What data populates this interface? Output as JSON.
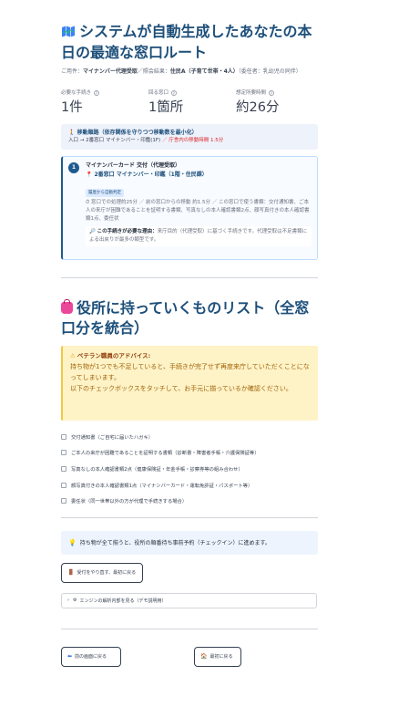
{
  "header": {
    "title": "システムが自動生成したあなたの本日の最適な窓口ルート",
    "meta_purpose_label": "ご用件：",
    "meta_purpose": "マイナンバー代理受取",
    "meta_sep1": "／照会結果：",
    "meta_result": "住民A（子育て世帯・4人）",
    "meta_note": "（委任者：乳幼児の同伴）"
  },
  "stats": [
    {
      "label": "必要な手続き",
      "value": "1件"
    },
    {
      "label": "回る窓口",
      "value": "1箇所"
    },
    {
      "label": "想定所要時間",
      "value": "約26分"
    }
  ],
  "route": {
    "title": "移動順路（依存関係を守りつつ移動数を最小化）",
    "path": "入口 → 2番窓口 マイナンバー・印鑑(1F)",
    "sep": "／",
    "time": "庁舎内の移動時間 1.5分"
  },
  "step": {
    "number": "1",
    "title": "マイナンバーカード 交付（代理受取）",
    "place": "2番窓口 マイナンバー・印鑑（1階・住民課）",
    "tag": "履歴から自動判定",
    "desc": "⏱ 窓口での処理約25分 ／ 前の窓口からの移動 約1.5分 ／ この窓口で使う書類：交付通知書、ご本人の来庁が困難であることを証明する書類、写真なしの本人確認書類2点、顔写真付きの本人確認書類1点、委任状",
    "why_label": "この手続きが必要な理由：",
    "why_text": "来庁目的（代理受取）に基づく手続きです。代理受取は不足書類による出戻りが最多の類型です。"
  },
  "checklist": {
    "title": "役所に持っていくものリスト（全窓口分を統合）",
    "advice_title": "ベテラン職員のアドバイス:",
    "advice_text1": "持ち物が1つでも不足していると、手続きが完了せず再度来庁していただくことになってしまいます。",
    "advice_text2": "以下のチェックボックスをタッチして、お手元に揃っているか確認ください。",
    "items": [
      "交付通知書（ご自宅に届いたハガキ）",
      "ご本人の来庁が困難であることを証明する書類（診断書・障害者手帳・介護保険証等）",
      "写真なしの本人確認書類2点（健康保険証・年金手帳・診察券等の組み合わせ）",
      "顔写真付きの本人確認書類1点（マイナンバーカード・運転免許証・パスポート等）",
      "委任状（同一世帯以外の方が代理で手続きする場合）"
    ]
  },
  "info": {
    "text": "持ち物が全て揃うと、役所の順番待ち事前予約（チェックイン）に進めます。"
  },
  "buttons": {
    "back_to_start": "受付をやり直す、最初に戻る",
    "engine": "エンジンの解析内部を見る（デモ説明用）",
    "prev_screen": "前の画面に戻る",
    "first": "最初に戻る"
  }
}
